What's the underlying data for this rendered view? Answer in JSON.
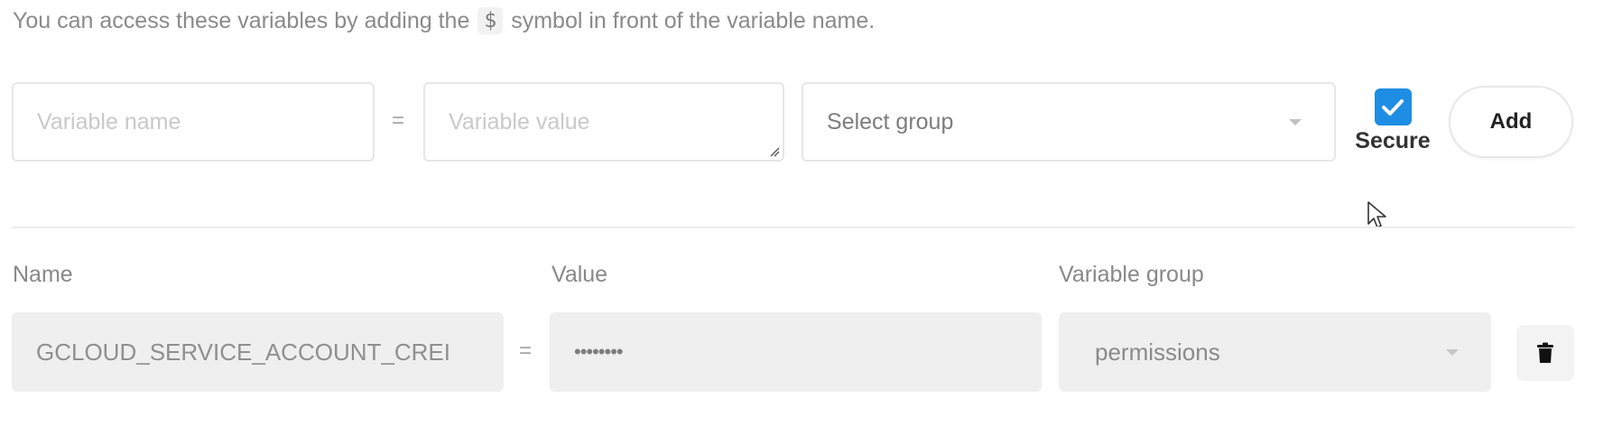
{
  "hint": {
    "before": "You can access these variables by adding the",
    "symbol": "$",
    "after": "symbol in front of the variable name."
  },
  "form": {
    "name_placeholder": "Variable name",
    "equals": "=",
    "value_placeholder": "Variable value",
    "group_placeholder": "Select group",
    "secure_label": "Secure",
    "secure_checked": true,
    "add_label": "Add"
  },
  "table": {
    "headers": {
      "name": "Name",
      "value": "Value",
      "group": "Variable group"
    },
    "rows": [
      {
        "name": "GCLOUD_SERVICE_ACCOUNT_CREI",
        "equals": "=",
        "value": "••••••••",
        "group": "permissions"
      }
    ]
  },
  "colors": {
    "accent": "#1e8de4",
    "row_bg": "#efefef"
  },
  "icons": {
    "select_caret": "chevron-down-icon",
    "checkbox": "checkmark-icon",
    "delete": "trash-icon",
    "cursor": "mouse-pointer-icon"
  }
}
